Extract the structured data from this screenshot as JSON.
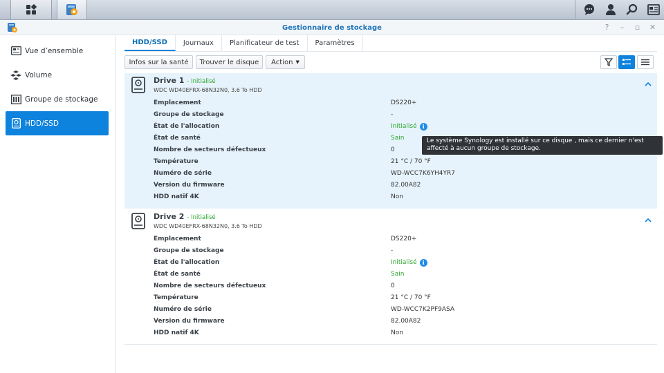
{
  "window": {
    "title": "Gestionnaire de stockage"
  },
  "sidebar": {
    "items": [
      {
        "label": "Vue d’ensemble",
        "icon": "overview-icon"
      },
      {
        "label": "Volume",
        "icon": "volume-icon"
      },
      {
        "label": "Groupe de stockage",
        "icon": "storage-pool-icon"
      },
      {
        "label": "HDD/SSD",
        "icon": "hdd-icon",
        "active": true
      }
    ]
  },
  "tabs": [
    {
      "label": "HDD/SSD",
      "active": true
    },
    {
      "label": "Journaux"
    },
    {
      "label": "Planificateur de test"
    },
    {
      "label": "Paramètres"
    }
  ],
  "toolbar": {
    "health_info": "Infos sur la santé",
    "find_disk": "Trouver le disque",
    "action": "Action"
  },
  "labels": {
    "location": "Emplacement",
    "storage_pool": "Groupe de stockage",
    "allocation_state": "État de l'allocation",
    "health_state": "État de santé",
    "bad_sectors": "Nombre de secteurs défectueux",
    "temperature": "Température",
    "serial": "Numéro de série",
    "firmware": "Version du firmware",
    "native_4k": "HDD natif 4K"
  },
  "drives": [
    {
      "name": "Drive 1",
      "status": "- Initialisé",
      "model": "WDC WD40EFRX-68N32N0, 3.6 To HDD",
      "location": "DS220+",
      "storage_pool": "-",
      "allocation_state": "Initialisé",
      "health_state": "Sain",
      "bad_sectors": "0",
      "temperature": "21 °C / 70 °F",
      "serial": "WD-WCC7K6YH4YR7",
      "firmware": "82.00A82",
      "native_4k": "Non"
    },
    {
      "name": "Drive 2",
      "status": "- Initialisé",
      "model": "WDC WD40EFRX-68N32N0, 3.6 To HDD",
      "location": "DS220+",
      "storage_pool": "-",
      "allocation_state": "Initialisé",
      "health_state": "Sain",
      "bad_sectors": "0",
      "temperature": "21 °C / 70 °F",
      "serial": "WD-WCC7K2PF9ASA",
      "firmware": "82.00A82",
      "native_4k": "Non"
    }
  ],
  "tooltip": {
    "line1": "Le système Synology est installé sur ce disque , mais ce dernier n'est",
    "line2": "affecté à aucun groupe de stockage."
  },
  "colors": {
    "accent": "#0e83dd",
    "status_green": "#2aa52a",
    "title_blue": "#1d73b8"
  }
}
